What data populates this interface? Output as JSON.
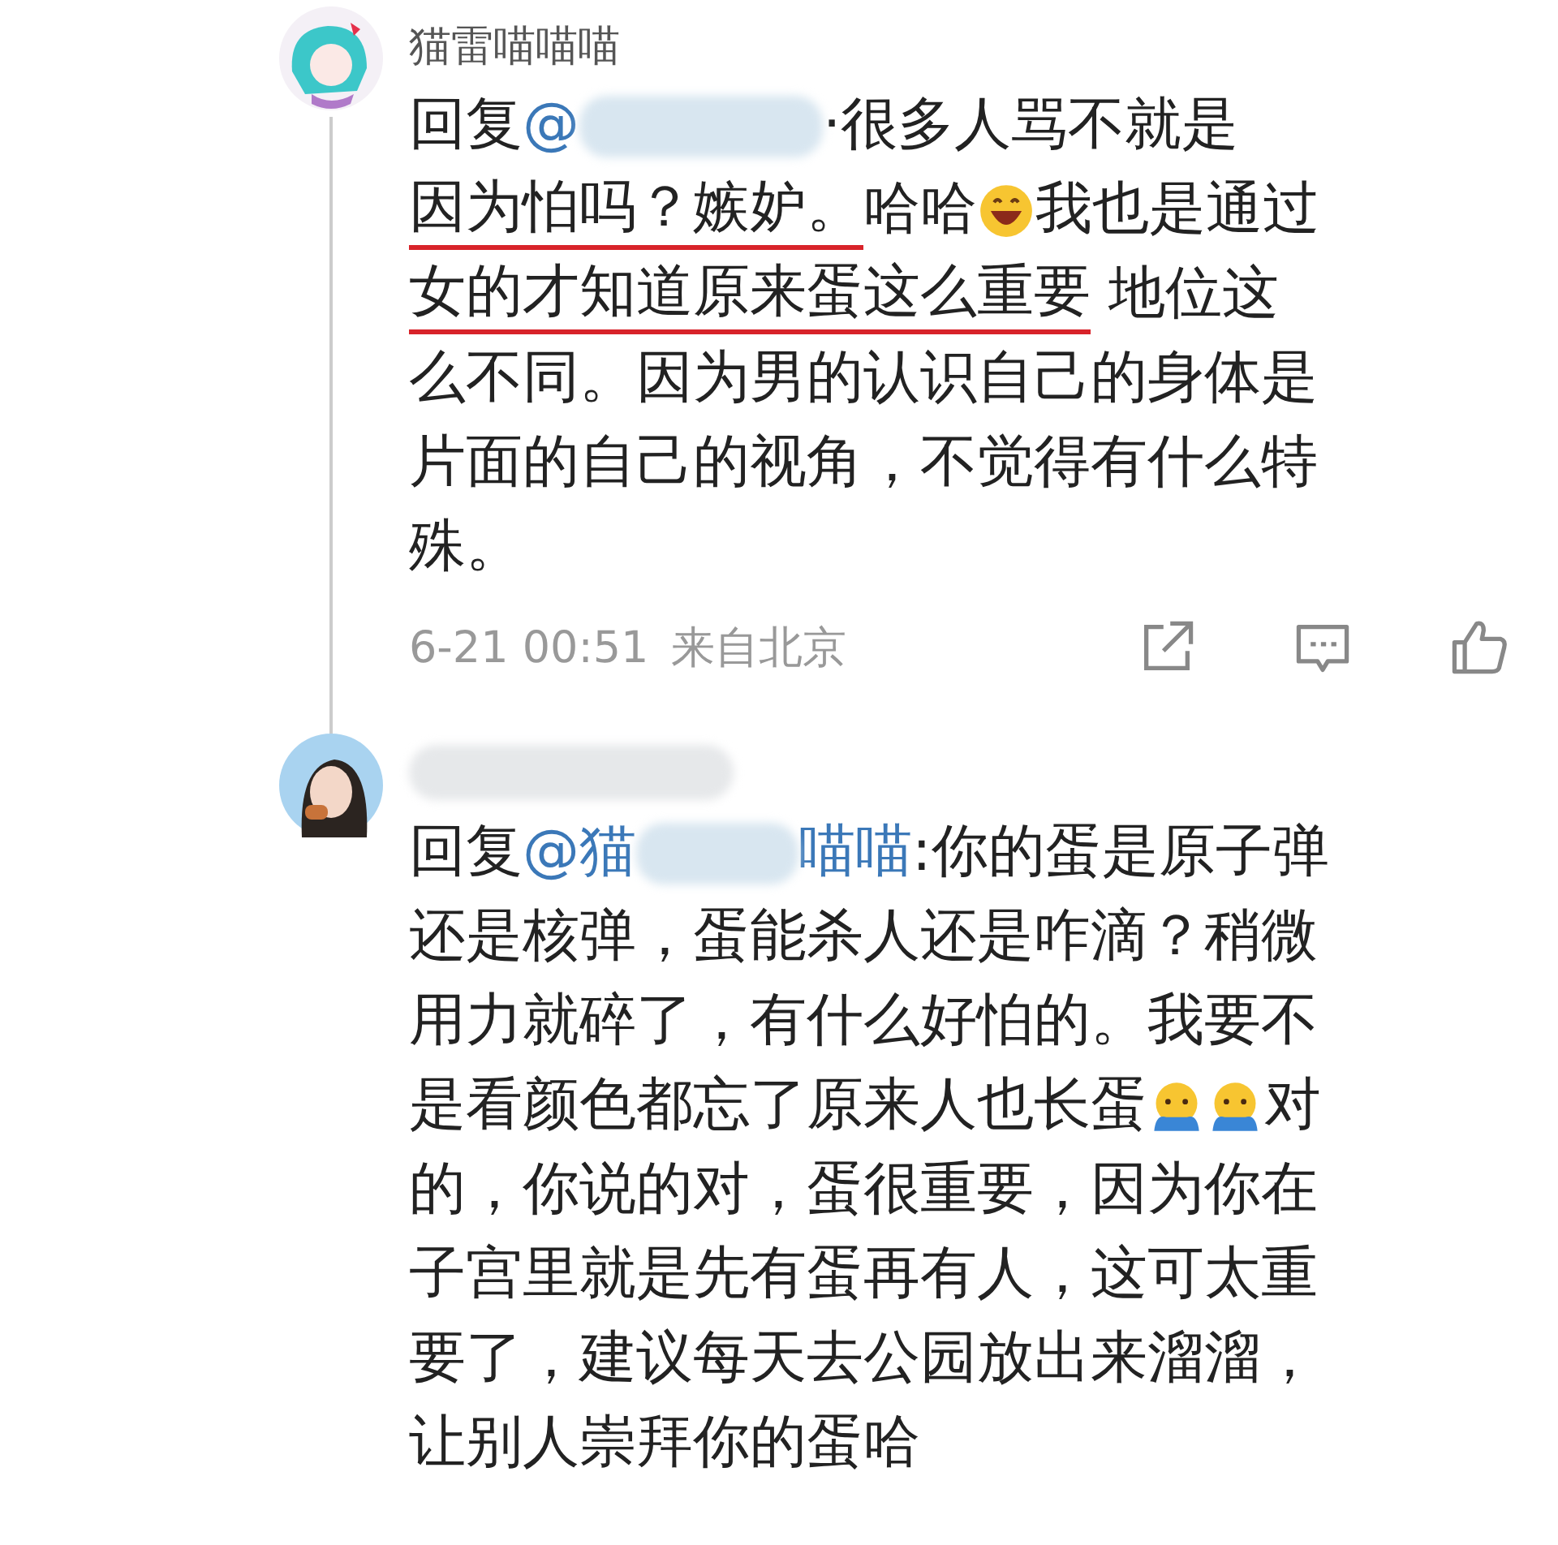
{
  "comments": [
    {
      "username": "猫雷喵喵喵",
      "avatar": {
        "kind": "picture"
      },
      "lines": [
        [
          {
            "kind": "text",
            "text": "回复"
          },
          {
            "kind": "mention",
            "text": "@"
          },
          {
            "kind": "redaction"
          },
          {
            "kind": "text",
            "text": "·很多人骂不就是"
          }
        ],
        [
          {
            "kind": "text",
            "text": "因为怕吗？嫉妒。",
            "underlined": true
          },
          {
            "kind": "text",
            "text": "哈哈"
          },
          {
            "kind": "emoji"
          },
          {
            "kind": "text",
            "text": "我也是通过"
          }
        ],
        [
          {
            "kind": "text",
            "text": "女的才知道原来蛋这么重要",
            "underlined": true
          },
          {
            "kind": "text",
            "text": " 地位这"
          }
        ],
        [
          {
            "kind": "text",
            "text": "么不同。因为男的认识自己的身体是"
          }
        ],
        [
          {
            "kind": "text",
            "text": "片面的自己的视角，不觉得有什么特"
          }
        ],
        [
          {
            "kind": "text",
            "text": "殊。"
          }
        ]
      ],
      "time": "6-21 00:51",
      "location": "来自北京"
    },
    {
      "avatar": {
        "kind": "picture"
      },
      "lines": [
        [
          {
            "kind": "text",
            "text": "回复"
          },
          {
            "kind": "mention",
            "text": "@猫"
          },
          {
            "kind": "redaction"
          },
          {
            "kind": "mention",
            "text": "喵喵"
          },
          {
            "kind": "text",
            "text": ":你的蛋是原子弹"
          }
        ],
        [
          {
            "kind": "text",
            "text": "还是核弹，蛋能杀人还是咋滴？稍微"
          }
        ],
        [
          {
            "kind": "text",
            "text": "用力就碎了，有什么好怕的。我要不"
          }
        ],
        [
          {
            "kind": "text",
            "text": "是看颜色都忘了原来人也长蛋"
          },
          {
            "kind": "emoji"
          },
          {
            "kind": "emoji"
          },
          {
            "kind": "text",
            "text": "对"
          }
        ],
        [
          {
            "kind": "text",
            "text": "的，你说的对，蛋很重要，因为你在"
          }
        ],
        [
          {
            "kind": "text",
            "text": "子宫里就是先有蛋再有人，这可太重"
          }
        ],
        [
          {
            "kind": "text",
            "text": "要了，建议每天去公园放出来溜溜，"
          }
        ],
        [
          {
            "kind": "text",
            "text": "让别人崇拜你的蛋哈"
          }
        ]
      ]
    }
  ]
}
